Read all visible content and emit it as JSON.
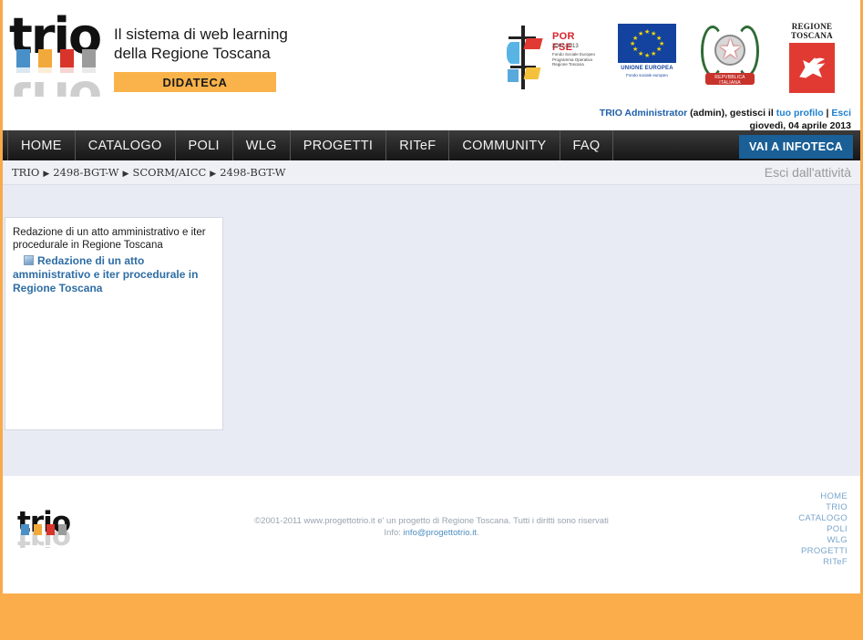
{
  "header": {
    "logo_text": "trio",
    "logo_alt": "trio-logo",
    "tagline_line1": "Il sistema di web learning",
    "tagline_line2": "della Regione Toscana",
    "didateca_label": "DIDATECA",
    "logos": {
      "por_fse": {
        "title": "POR FSE",
        "years": "2007-2013",
        "sub_line1": "Fondo Sociale Europeo",
        "sub_line2": "Programma Operativo",
        "sub_line3": "Regione Toscana"
      },
      "eu": {
        "caption": "UNIONE EUROPEA",
        "caption2": "Fondo sociale europeo"
      },
      "repubblica": {
        "ribbon": "REPVBBLICA ITALIANA"
      },
      "regione_toscana": {
        "line1": "REGIONE",
        "line2": "TOSCANA"
      }
    }
  },
  "userbar": {
    "user_name": "TRIO Administrator",
    "user_login": " (admin), gestisci il ",
    "profile_link": "tuo profilo",
    "separator": " | ",
    "logout_link": "Esci",
    "date": "giovedì, 04 aprile 2013"
  },
  "nav": {
    "items": [
      {
        "label": "HOME"
      },
      {
        "label": "CATALOGO"
      },
      {
        "label": "POLI"
      },
      {
        "label": "WLG"
      },
      {
        "label": "PROGETTI"
      },
      {
        "label": "RITeF"
      },
      {
        "label": "COMMUNITY"
      },
      {
        "label": "FAQ"
      }
    ],
    "infoteca_label": "VAI A INFOTECA"
  },
  "breadcrumb": {
    "items": [
      "TRIO",
      "2498-BGT-W",
      "SCORM/AICC",
      "2498-BGT-W"
    ],
    "separator": "▶",
    "exit_activity": "Esci dall'attività"
  },
  "content": {
    "panel": {
      "title": "Redazione di un atto amministrativo e iter procedurale in Regione Toscana",
      "sco_link": "Redazione di un atto amministrativo e iter procedurale in Regione Toscana",
      "sco_icon": "sco-package-icon"
    }
  },
  "footer": {
    "logo_text": "trio",
    "copyright": "©2001-2011 www.progettotrio.it e' un progetto di Regione Toscana. Tutti i diritti sono riservati",
    "info_label": "Info: ",
    "info_email": "info@progettotrio.it",
    "info_suffix": ".",
    "links": [
      {
        "label": "HOME"
      },
      {
        "label": "TRIO"
      },
      {
        "label": "CATALOGO"
      },
      {
        "label": "POLI"
      },
      {
        "label": "WLG"
      },
      {
        "label": "PROGETTI"
      },
      {
        "label": "RITeF"
      }
    ]
  },
  "colors": {
    "orange_accent": "#f9a94a",
    "didateca_bg": "#f9b34a",
    "nav_bg": "#2a2a2a",
    "infoteca_bg": "#1a5f96",
    "content_bg": "#e8ebf3",
    "link_blue": "#2e6da4",
    "bottom_band": "#fbad4b"
  }
}
